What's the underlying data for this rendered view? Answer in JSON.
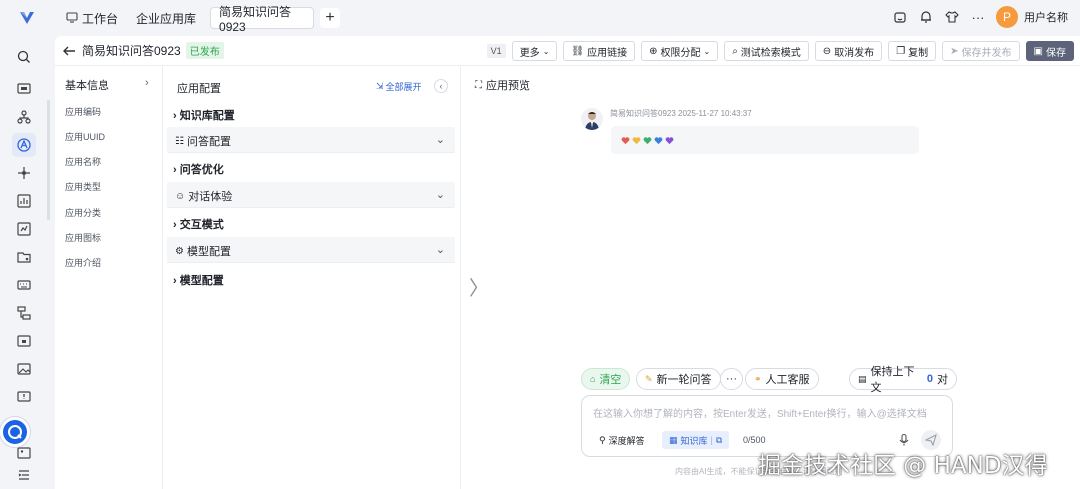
{
  "topbar": {
    "home_label": "工作台",
    "tabs": [
      {
        "label": "企业应用库"
      },
      {
        "label": "简易知识问答0923"
      }
    ],
    "user_initial": "P",
    "user_name": "用户名称",
    "icons": [
      "home-icon",
      "bell-icon",
      "shirt-icon",
      "more-icon"
    ]
  },
  "subbar": {
    "back_icon": "arrow-left-icon",
    "app_title": "简易知识问答0923",
    "status_badge": "已发布",
    "version": "V1",
    "buttons": {
      "more": "更多",
      "app_link": "应用链接",
      "permission": "权限分配",
      "test_mode": "测试检索模式",
      "unpublish": "取消发布",
      "copy": "复制",
      "save_publish": "保存并发布",
      "save": "保存"
    }
  },
  "basic_info": {
    "title": "基本信息",
    "items": [
      "应用编码",
      "应用UUID",
      "应用名称",
      "应用类型",
      "应用分类",
      "应用图标",
      "应用介绍"
    ]
  },
  "app_config": {
    "title": "应用配置",
    "expand_all": "全部展开",
    "sections": [
      {
        "label": "知识库配置",
        "type": "section"
      },
      {
        "label": "问答配置",
        "type": "sub"
      },
      {
        "label": "问答优化",
        "type": "section"
      },
      {
        "label": "对话体验",
        "type": "sub"
      },
      {
        "label": "交互模式",
        "type": "section"
      },
      {
        "label": "模型配置",
        "type": "sub"
      },
      {
        "label": "模型配置",
        "type": "section"
      }
    ]
  },
  "preview": {
    "title": "应用预览",
    "bot_meta": "简易知识问答0923 2025-11-27 10:43:37",
    "hearts": [
      "#e85a4f",
      "#f2b93b",
      "#3fb06b",
      "#3b7fe0",
      "#8a4fd8"
    ],
    "quick": {
      "clear": "清空",
      "new_round": "新一轮问答",
      "more": "···",
      "human": "人工客服",
      "keep_context": "保持上下文",
      "context_count": "0",
      "context_unit": "对"
    },
    "input_placeholder": "在这输入你想了解的内容，按Enter发送，Shift+Enter换行，输入@选择文档",
    "deep_answer": "深度解答",
    "knowledge_base": "知识库",
    "char_count": "0/500",
    "footer_note": "内容由AI生成，不能保证完全准确，请仔细甄别",
    "watermark": "掘金技术社区 @ HAND汉得"
  },
  "colors": {
    "accent": "#3366d6",
    "avatar": "#f59a3d",
    "badge_green": "#2ea44f",
    "save_btn": "#5d6479"
  }
}
